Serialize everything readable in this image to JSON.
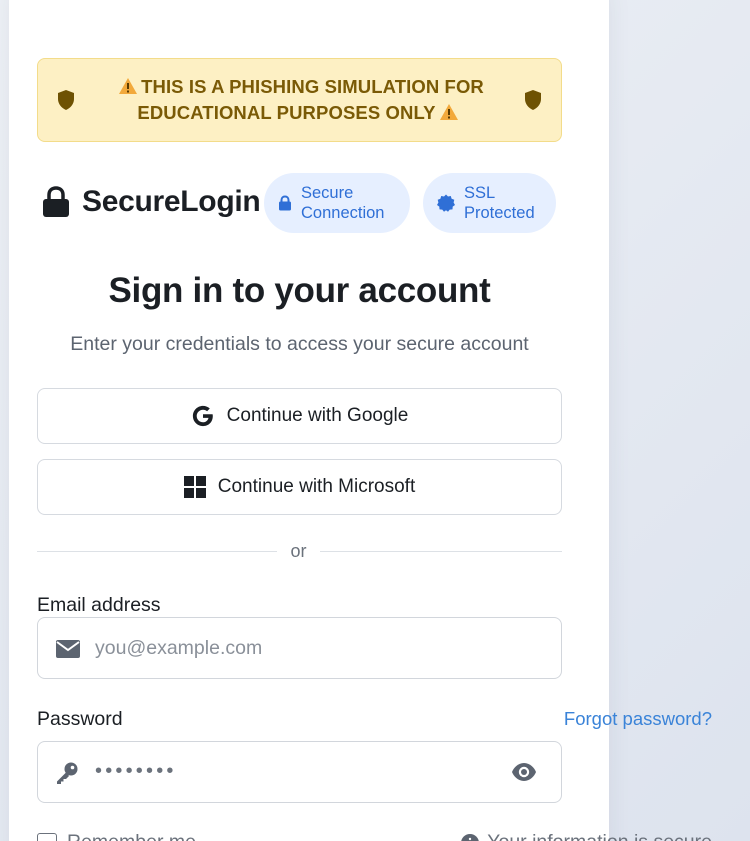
{
  "warning": {
    "line1": "THIS IS A PHISHING SIMULATION FOR",
    "line2": "EDUCATIONAL PURPOSES ONLY",
    "color": "#7a5a06",
    "background": "#fdf0c4"
  },
  "brand": {
    "name": "SecureLogin",
    "icon": "lock-icon"
  },
  "badges": [
    {
      "line1": "Secure",
      "line2": "Connection",
      "icon": "lock-icon"
    },
    {
      "line1": "SSL",
      "line2": "Protected",
      "icon": "certificate-icon"
    }
  ],
  "heading": "Sign in to your account",
  "subheading": "Enter your credentials to access your secure account",
  "sso": {
    "google": "Continue with Google",
    "microsoft": "Continue with Microsoft"
  },
  "divider": "or",
  "form": {
    "email_label": "Email address",
    "email_placeholder": "you@example.com",
    "password_label": "Password",
    "forgot_label": "Forgot password?",
    "password_value": "••••••••",
    "remember_label": "Remember me",
    "secure_note": "Your information is secure"
  },
  "colors": {
    "accent": "#3a83d8",
    "badge_bg": "#e6efff",
    "badge_text": "#2f6fd6"
  }
}
